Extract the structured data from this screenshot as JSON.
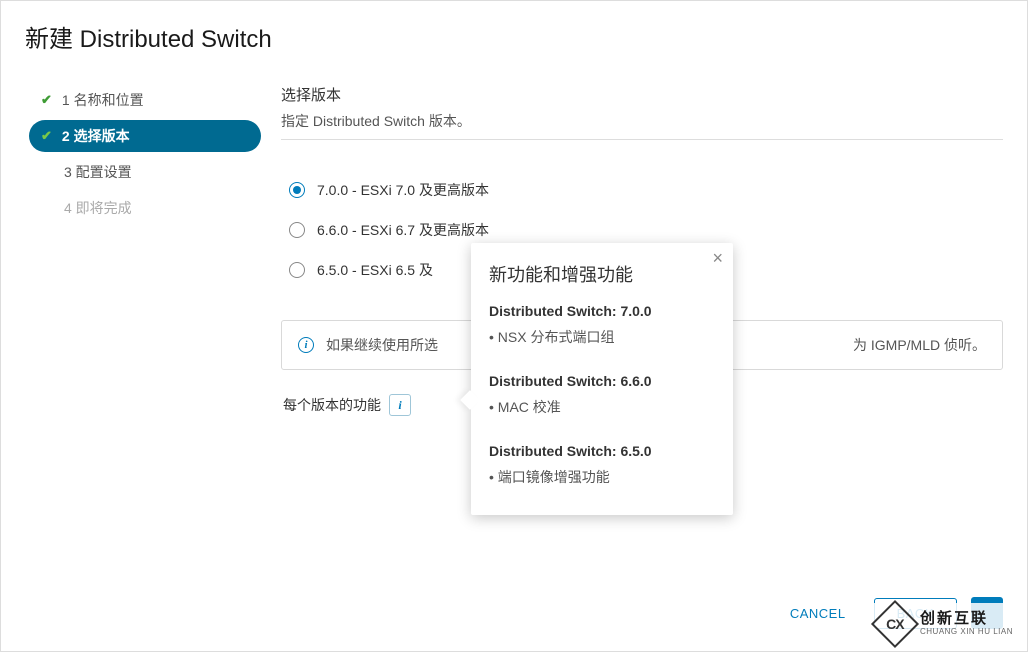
{
  "dialog": {
    "title_cn": "新建",
    "title_en": " Distributed Switch"
  },
  "wizard": {
    "steps": [
      {
        "label": "1 名称和位置"
      },
      {
        "label": "2 选择版本"
      },
      {
        "label": "3 配置设置"
      },
      {
        "label": "4 即将完成"
      }
    ]
  },
  "pane": {
    "title": "选择版本",
    "subtitle": "指定 Distributed Switch 版本。",
    "options": [
      {
        "label": "7.0.0 - ESXi 7.0 及更高版本"
      },
      {
        "label": "6.6.0 - ESXi 6.7 及更高版本"
      },
      {
        "label": "6.5.0 - ESXi 6.5 及"
      }
    ],
    "info_prefix": "如果继续使用所选",
    "info_suffix": "为 IGMP/MLD 侦听。",
    "func_label": "每个版本的功能"
  },
  "popover": {
    "title": "新功能和增强功能",
    "sections": [
      {
        "title": "Distributed Switch: 7.0.0",
        "item": "• NSX 分布式端口组"
      },
      {
        "title": "Distributed Switch: 6.6.0",
        "item": "• MAC 校准"
      },
      {
        "title": "Distributed Switch: 6.5.0",
        "item": "• 端口镜像增强功能"
      }
    ]
  },
  "footer": {
    "cancel": "CANCEL",
    "back": "BACK"
  },
  "watermark": {
    "logo": "CX",
    "cn": "创新互联",
    "en": "CHUANG XIN HU LIAN"
  }
}
